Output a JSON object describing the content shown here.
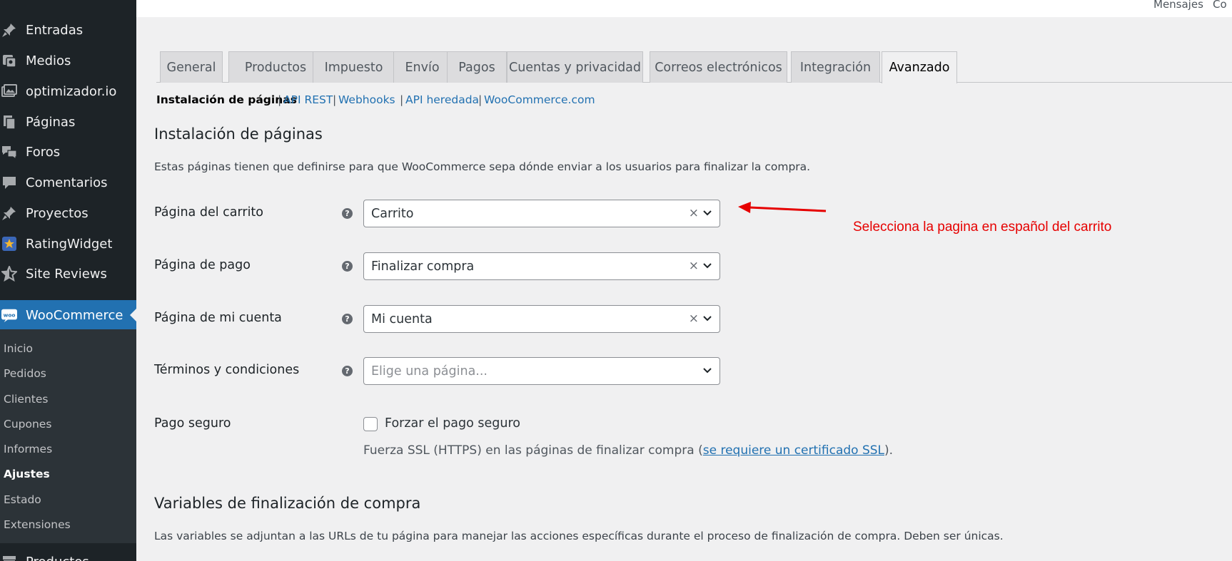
{
  "topbar": {
    "messages": "Mensajes",
    "truncated": "Co"
  },
  "sidebar": {
    "items": [
      {
        "label": "Entradas",
        "icon": "pin-icon"
      },
      {
        "label": "Medios",
        "icon": "media-icon"
      },
      {
        "label": "optimizador.io",
        "icon": "gallery-icon"
      },
      {
        "label": "Páginas",
        "icon": "pages-icon"
      },
      {
        "label": "Foros",
        "icon": "forums-icon"
      },
      {
        "label": "Comentarios",
        "icon": "comment-icon"
      },
      {
        "label": "Proyectos",
        "icon": "pin-icon"
      },
      {
        "label": "RatingWidget",
        "icon": "star-badge-icon"
      },
      {
        "label": "Site Reviews",
        "icon": "star-icon"
      },
      {
        "label": "WooCommerce",
        "icon": "woo-icon"
      },
      {
        "label": "Productos",
        "icon": "archive-icon"
      }
    ],
    "submenu": [
      "Inicio",
      "Pedidos",
      "Clientes",
      "Cupones",
      "Informes",
      "Ajustes",
      "Estado",
      "Extensiones"
    ],
    "current_submenu": "Ajustes"
  },
  "tabs": [
    "General",
    "Productos",
    "Impuesto",
    "Envío",
    "Pagos",
    "Cuentas y privacidad",
    "Correos electrónicos",
    "Integración",
    "Avanzado"
  ],
  "active_tab": "Avanzado",
  "subsub": {
    "current": "Instalación de páginas",
    "links": [
      "API REST",
      "Webhooks",
      "API heredada",
      "WooCommerce.com"
    ],
    "separator": "|"
  },
  "section1": {
    "title": "Instalación de páginas",
    "description": "Estas páginas tienen que definirse para que WooCommerce sepa dónde enviar a los usuarios para finalizar la compra."
  },
  "fields": [
    {
      "label": "Página del carrito",
      "value": "Carrito",
      "clearable": true
    },
    {
      "label": "Página de pago",
      "value": "Finalizar compra",
      "clearable": true
    },
    {
      "label": "Página de mi cuenta",
      "value": "Mi cuenta",
      "clearable": true
    },
    {
      "label": "Términos y condiciones",
      "placeholder": "Elige una página...",
      "clearable": false
    }
  ],
  "secure": {
    "label": "Pago seguro",
    "checkbox_label": "Forzar el pago seguro",
    "checked": false,
    "note_before": "Fuerza SSL (HTTPS) en las páginas de finalizar compra (",
    "note_link": "se requiere un certificado SSL",
    "note_after": ")."
  },
  "section2": {
    "title": "Variables de finalización de compra",
    "description": "Las variables se adjuntan a las URLs de tu página para manejar las acciones específicas durante el proceso de finalización de compra. Deben ser únicas."
  },
  "annotation": {
    "text": "Selecciona la pagina en español del carrito",
    "color": "#e60000"
  },
  "colors": {
    "accent": "#2271b1",
    "sidebar_bg": "#1d2327",
    "submenu_bg": "#2c3338"
  }
}
